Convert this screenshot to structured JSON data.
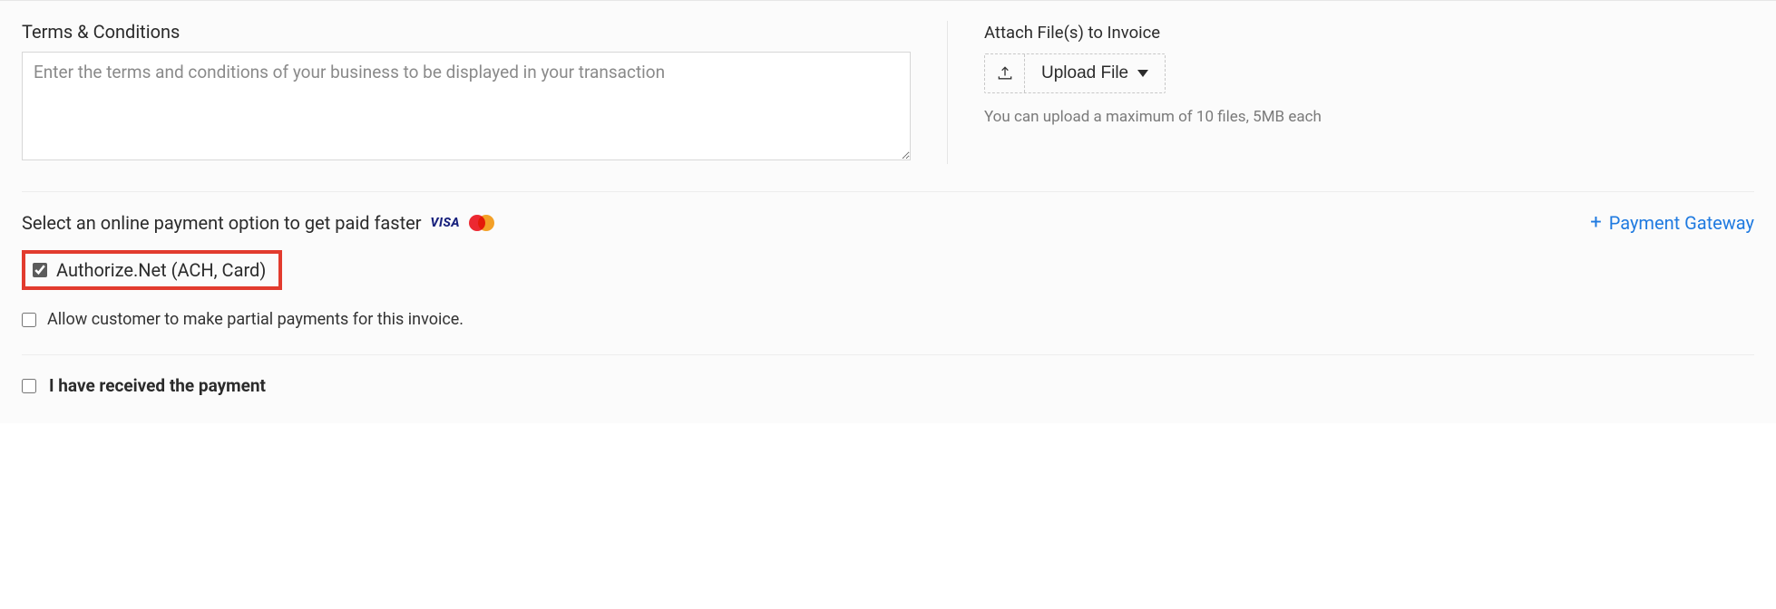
{
  "terms": {
    "title": "Terms & Conditions",
    "placeholder": "Enter the terms and conditions of your business to be displayed in your transaction",
    "value": ""
  },
  "attach": {
    "title": "Attach File(s) to Invoice",
    "upload_label": "Upload File",
    "hint": "You can upload a maximum of 10 files, 5MB each"
  },
  "payment": {
    "prompt": "Select an online payment option to get paid faster",
    "add_gateway_label": "Payment Gateway",
    "gateway_option_label": "Authorize.Net (ACH, Card)",
    "gateway_option_checked": true,
    "partial_label": "Allow customer to make partial payments for this invoice.",
    "partial_checked": false
  },
  "received": {
    "label": "I have received the payment",
    "checked": false
  },
  "icons": {
    "visa": "VISA"
  }
}
